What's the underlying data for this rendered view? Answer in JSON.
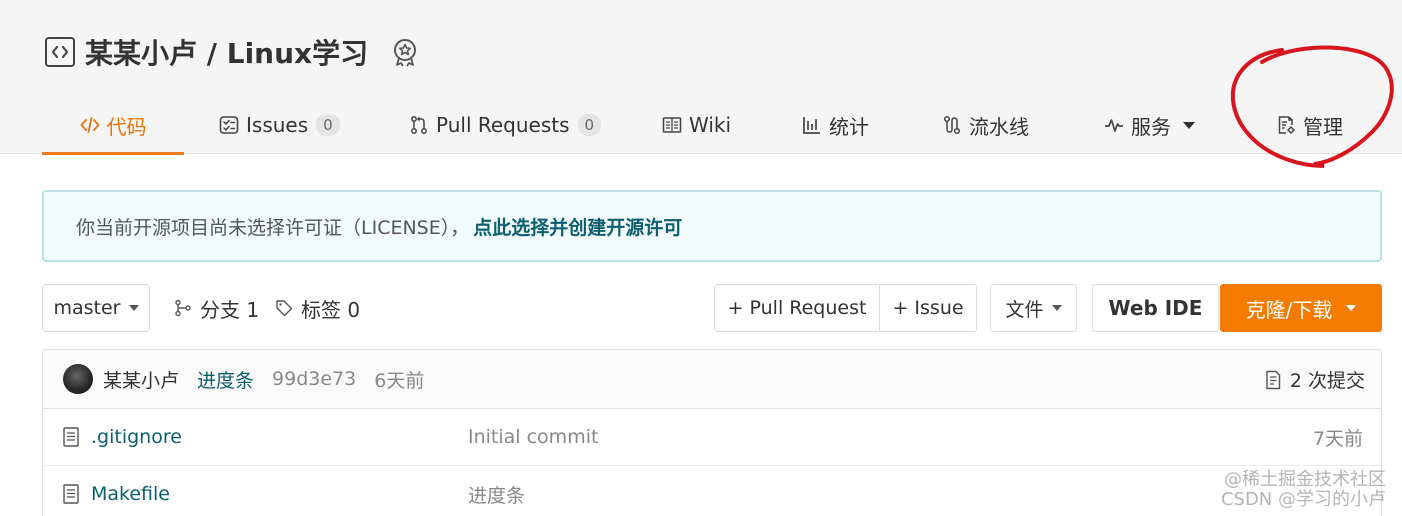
{
  "repo": {
    "title": "某某小卢 / Linux学习"
  },
  "nav": {
    "items": [
      {
        "label": "代码",
        "icon": "code-icon",
        "active": true
      },
      {
        "label": "Issues",
        "icon": "issues-icon",
        "badge": "0"
      },
      {
        "label": "Pull Requests",
        "icon": "pull-request-icon",
        "badge": "0"
      },
      {
        "label": "Wiki",
        "icon": "book-icon"
      },
      {
        "label": "统计",
        "icon": "bar-chart-icon"
      },
      {
        "label": "流水线",
        "icon": "pipeline-icon"
      },
      {
        "label": "服务",
        "icon": "pulse-icon"
      },
      {
        "label": "管理",
        "icon": "settings-doc-icon"
      }
    ]
  },
  "notice": {
    "text": "你当前开源项目尚未选择许可证（LICENSE），",
    "link": "点此选择并创建开源许可"
  },
  "toolbar": {
    "branch": "master",
    "branches_label": "分支 1",
    "tags_label": "标签 0",
    "pull_request": "+ Pull Request",
    "issue": "+ Issue",
    "file": "文件",
    "web_ide": "Web IDE",
    "clone": "克隆/下载"
  },
  "commit": {
    "author": "某某小卢",
    "message": "进度条",
    "sha": "99d3e73",
    "time": "6天前",
    "count": "2 次提交"
  },
  "files": [
    {
      "name": ".gitignore",
      "message": "Initial commit",
      "time": "7天前"
    },
    {
      "name": "Makefile",
      "message": "进度条",
      "time": ""
    }
  ],
  "watermark": {
    "line1": "@稀土掘金技术社区",
    "line2": "CSDN @学习的小卢"
  },
  "colors": {
    "accent": "#f07a1c",
    "link": "#0b5e6e",
    "clone_button": "#f57b00",
    "annotation": "#d8141e"
  }
}
